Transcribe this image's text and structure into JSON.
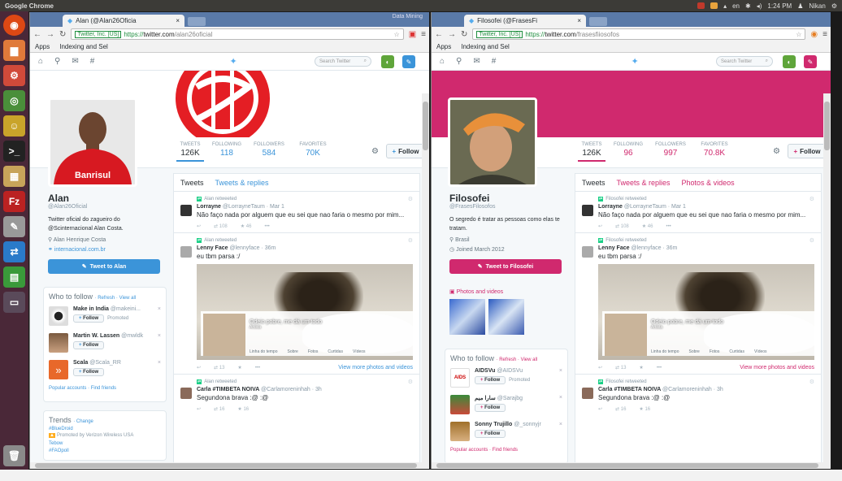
{
  "os": {
    "app_title": "Google Chrome",
    "time": "1:24 PM",
    "user": "Nikan",
    "lang": "en"
  },
  "windows": [
    {
      "tab_title": "Alan (@Alan26Oficia",
      "tab_extra": "Data Mining",
      "url": {
        "secure_label": "Twitter, Inc. [US]",
        "proto": "https://",
        "host": "twitter.com",
        "path": "/alan26oficial"
      },
      "bookmarks": [
        "Apps",
        "Indexing and Sel"
      ],
      "search_placeholder": "Search Twitter",
      "accent": "#3b94d9",
      "stats": [
        {
          "label": "TWEETS",
          "value": "126K"
        },
        {
          "label": "FOLLOWING",
          "value": "118"
        },
        {
          "label": "FOLLOWERS",
          "value": "584"
        },
        {
          "label": "FAVORITES",
          "value": "70K"
        }
      ],
      "follow_label": "Follow",
      "profile": {
        "name": "Alan",
        "handle": "@Alan26Oficial",
        "bio": "Twitter oficial do zagueiro do @Scinternacional Alan Costa.",
        "location": "Alan Henrique Costa",
        "website": "internacional.com.br",
        "tweet_to": "Tweet to Alan"
      },
      "who_to_follow": {
        "title": "Who to follow",
        "refresh": "Refresh",
        "view_all": "View all",
        "items": [
          {
            "name": "Make in India",
            "handle": "@makeini...",
            "follow": "Follow",
            "promoted": "Promoted"
          },
          {
            "name": "Martin W. Lassen",
            "handle": "@mwldk",
            "follow": "Follow",
            "promoted": ""
          },
          {
            "name": "Scala",
            "handle": "@Scala_RR",
            "follow": "Follow",
            "promoted": ""
          }
        ],
        "footer": "Popular accounts · Find friends"
      },
      "trends": {
        "title": "Trends",
        "change": "Change",
        "items": [
          "#BlueDroid",
          "Promoted by Verizon Wireless USA",
          "Tebow",
          "#FAOpoll"
        ]
      },
      "tabs": [
        "Tweets",
        "Tweets & replies"
      ],
      "tweets": [
        {
          "retweeted": "Alan retweeted",
          "author": "Lorrayne",
          "handle": "@LorrayneTaum · Mar 1",
          "text": "Não faço nada por alguem que eu sei que nao faria o mesmo por mim...",
          "rt": "108",
          "fav": "46"
        },
        {
          "retweeted": "Alan retweeted",
          "author": "Lenny Face",
          "handle": "@lennyface · 36m",
          "text": "eu tbm parsa :/",
          "rt": "13",
          "fav": "",
          "media_title": "Odeio pobre, me dá um todo",
          "media_sub": "Artista",
          "media_tabs": [
            "Linha do tempo",
            "Sobre",
            "Fotos",
            "Curtidas",
            "Vídeos"
          ],
          "more": "View more photos and videos"
        },
        {
          "retweeted": "Alan retweeted",
          "author": "Carla #TIMBETA NOIVA",
          "handle": "@Carlamoreninhah · 3h",
          "text": "Segundona brava :@ :@",
          "rt": "16",
          "fav": "16"
        }
      ]
    },
    {
      "tab_title": "Filosofei (@FrasesFi",
      "tab_extra": "",
      "url": {
        "secure_label": "Twitter, Inc. [US]",
        "proto": "https://",
        "host": "twitter.com",
        "path": "/frasesfiiosofos"
      },
      "bookmarks": [
        "Apps",
        "Indexing and Sel"
      ],
      "search_placeholder": "Search Twitter",
      "accent": "#d0296e",
      "stats": [
        {
          "label": "TWEETS",
          "value": "126K"
        },
        {
          "label": "FOLLOWING",
          "value": "96"
        },
        {
          "label": "FOLLOWERS",
          "value": "997"
        },
        {
          "label": "FAVORITES",
          "value": "70.8K"
        }
      ],
      "follow_label": "Follow",
      "profile": {
        "name": "Filosofei",
        "handle": "@FrasesFilosofos",
        "bio": "O segredo é tratar as pessoas como elas te tratam.",
        "location": "Brasil",
        "website": "Joined March 2012",
        "tweet_to": "Tweet to Filosofei"
      },
      "photos_label": "Photos and videos",
      "who_to_follow": {
        "title": "Who to follow",
        "refresh": "Refresh",
        "view_all": "View all",
        "items": [
          {
            "name": "AIDSVu",
            "handle": "@AIDSVu",
            "follow": "Follow",
            "promoted": "Promoted"
          },
          {
            "name": "سارا ميم",
            "handle": "@Sarajbg",
            "follow": "Follow",
            "promoted": ""
          },
          {
            "name": "Sonny Trujillo",
            "handle": "@_sonnyjr",
            "follow": "Follow",
            "promoted": ""
          }
        ],
        "footer": "Popular accounts · Find friends"
      },
      "tabs": [
        "Tweets",
        "Tweets & replies",
        "Photos & videos"
      ],
      "tweets": [
        {
          "retweeted": "Filosofei retweeted",
          "author": "Lorrayne",
          "handle": "@LorrayneTaum · Mar 1",
          "text": "Não faço nada por alguem que eu sei que nao faria o mesmo por mim...",
          "rt": "108",
          "fav": "46"
        },
        {
          "retweeted": "Filosofei retweeted",
          "author": "Lenny Face",
          "handle": "@lennyface · 36m",
          "text": "eu tbm parsa :/",
          "rt": "13",
          "fav": "",
          "media_title": "Odeio pobre, me dá um todo",
          "media_sub": "Artista",
          "media_tabs": [
            "Linha do tempo",
            "Sobre",
            "Fotos",
            "Curtidas",
            "Vídeos"
          ],
          "more": "View more photos and videos"
        },
        {
          "retweeted": "Filosofei retweeted",
          "author": "Carla #TIMBETA NOIVA",
          "handle": "@Carlamoreninhah · 3h",
          "text": "Segundona brava :@ :@",
          "rt": "16",
          "fav": "16"
        }
      ]
    }
  ]
}
